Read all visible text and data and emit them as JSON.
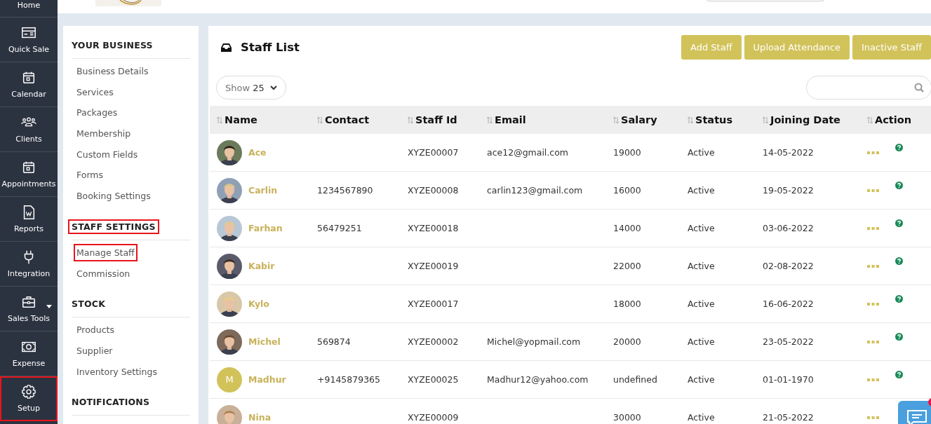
{
  "nav": [
    {
      "label": "Home",
      "highlighted": false
    },
    {
      "label": "Quick Sale",
      "highlighted": false
    },
    {
      "label": "Calendar",
      "highlighted": false
    },
    {
      "label": "Clients",
      "highlighted": false
    },
    {
      "label": "Appointments",
      "highlighted": false
    },
    {
      "label": "Reports",
      "highlighted": false
    },
    {
      "label": "Integration",
      "highlighted": false
    },
    {
      "label": "Sales Tools",
      "highlighted": false
    },
    {
      "label": "Expense",
      "highlighted": false
    },
    {
      "label": "Setup",
      "highlighted": true
    }
  ],
  "settings": [
    {
      "heading": "YOUR BUSINESS",
      "highlighted": false,
      "items": [
        {
          "label": "Business Details",
          "highlighted": false
        },
        {
          "label": "Services",
          "highlighted": false
        },
        {
          "label": "Packages",
          "highlighted": false
        },
        {
          "label": "Membership",
          "highlighted": false
        },
        {
          "label": "Custom Fields",
          "highlighted": false
        },
        {
          "label": "Forms",
          "highlighted": false
        },
        {
          "label": "Booking Settings",
          "highlighted": false
        }
      ]
    },
    {
      "heading": "STAFF SETTINGS",
      "highlighted": true,
      "items": [
        {
          "label": "Manage Staff",
          "highlighted": true
        },
        {
          "label": "Commission",
          "highlighted": false
        }
      ]
    },
    {
      "heading": "STOCK",
      "highlighted": false,
      "items": [
        {
          "label": "Products",
          "highlighted": false
        },
        {
          "label": "Supplier",
          "highlighted": false
        },
        {
          "label": "Inventory Settings",
          "highlighted": false
        }
      ]
    },
    {
      "heading": "NOTIFICATIONS",
      "highlighted": false
    }
  ],
  "title": "Staff List",
  "buttons": [
    "Add Staff",
    "Upload Attendance",
    "Inactive Staff"
  ],
  "page_size": {
    "label": "Show",
    "value": "25"
  },
  "table": {
    "columns": [
      "Name",
      "Contact",
      "Staff Id",
      "Email",
      "Salary",
      "Status",
      "Joining Date",
      "Action"
    ],
    "rows": [
      {
        "name": "Ace",
        "staff_id": "XYZE00007",
        "email": "ace12@gmail.com",
        "salary": "19000",
        "status": "Active",
        "joining_date": "14-05-2022"
      },
      {
        "name": "Carlin",
        "contact": "1234567890",
        "staff_id": "XYZE00008",
        "email": "carlin123@gmail.com",
        "salary": "16000",
        "status": "Active",
        "joining_date": "19-05-2022"
      },
      {
        "name": "Farhan",
        "contact": "56479251",
        "staff_id": "XYZE00018",
        "salary": "14000",
        "status": "Active",
        "joining_date": "03-06-2022"
      },
      {
        "name": "Kabir",
        "staff_id": "XYZE00019",
        "salary": "22000",
        "status": "Active",
        "joining_date": "02-08-2022"
      },
      {
        "name": "Kylo",
        "staff_id": "XYZE00017",
        "salary": "18000",
        "status": "Active",
        "joining_date": "16-06-2022"
      },
      {
        "name": "Michel",
        "contact": "569874",
        "staff_id": "XYZE00002",
        "email": "Michel@yopmail.com",
        "salary": "20000",
        "status": "Active",
        "joining_date": "23-05-2022"
      },
      {
        "avatar": {
          "kind": "initial",
          "initial": "M"
        },
        "name": "Madhur",
        "contact": "+9145879365",
        "staff_id": "XYZE00025",
        "email": "Madhur12@yahoo.com",
        "salary": "undefined",
        "status": "Active",
        "joining_date": "01-01-1970"
      },
      {
        "name": "Nina",
        "staff_id": "XYZE00009",
        "salary": "30000",
        "status": "Active",
        "joining_date": "21-05-2022"
      }
    ]
  }
}
